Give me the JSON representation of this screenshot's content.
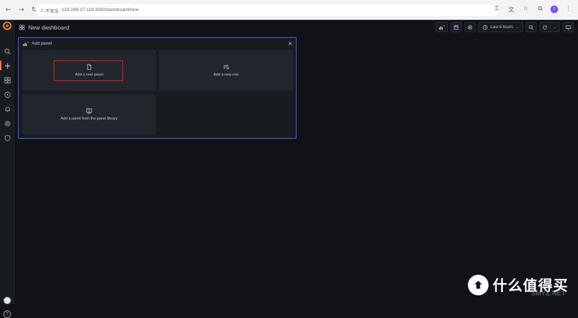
{
  "browser": {
    "security_label": "不安全",
    "url": "123.249.27.118:3000/dashboard/new",
    "profile_initial": "c"
  },
  "sidebar": {
    "items": [
      {
        "icon": "search-icon"
      },
      {
        "icon": "plus-icon"
      },
      {
        "icon": "dashboards-icon"
      },
      {
        "icon": "compass-icon"
      },
      {
        "icon": "bell-icon"
      },
      {
        "icon": "gear-icon"
      },
      {
        "icon": "shield-icon"
      }
    ]
  },
  "header": {
    "title": "New dashboard",
    "time_range": "Last 6 hours"
  },
  "add_panel": {
    "title": "Add panel",
    "options": [
      {
        "label": "Add a new panel",
        "icon": "file-icon"
      },
      {
        "label": "Add a new row",
        "icon": "row-icon"
      },
      {
        "label": "Add a panel from the panel library",
        "icon": "library-icon"
      }
    ]
  },
  "watermark": {
    "text": "什么值得买",
    "sub": "SMYZ.NET"
  },
  "colors": {
    "accent_border": "#3d71d9",
    "highlight": "#e02020",
    "background": "#111217"
  }
}
